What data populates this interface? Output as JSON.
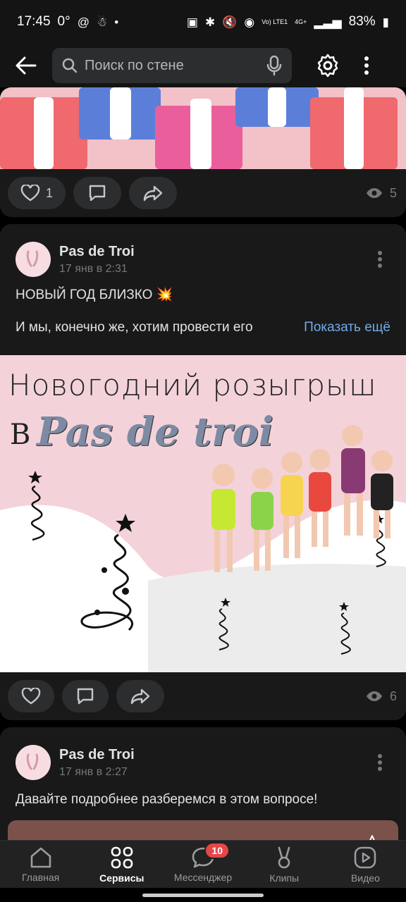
{
  "status_bar": {
    "time": "17:45",
    "left_extra": "0°",
    "battery": "83%",
    "icons": [
      "at-icon",
      "notification-icon",
      "nfc-icon",
      "bluetooth-icon",
      "mute-icon",
      "wifi-icon",
      "signal-icon",
      "battery-icon"
    ],
    "volte_label": "Vo) LTE1",
    "net_label": "4G+"
  },
  "app_bar": {
    "search_placeholder": "Поиск по стене",
    "icons": [
      "back-arrow-icon",
      "search-icon",
      "microphone-icon",
      "gear-icon",
      "more-vertical-icon"
    ]
  },
  "posts": [
    {
      "likes": "1",
      "views": "5"
    },
    {
      "author": "Pas de Troi",
      "date": "17 янв в 2:31",
      "title": "НОВЫЙ ГОД БЛИЗКО 💥",
      "excerpt": "И мы, конечно же, хотим провести его",
      "show_more": "Показать ещё",
      "image": {
        "headline": "Новогодний розыгрыш",
        "v": "В",
        "brand": "Pas de troi"
      },
      "views": "6"
    },
    {
      "author": "Pas de Troi",
      "date": "17 янв в 2:27",
      "text": "Давайте подробнее разберемся в этом вопросе!"
    }
  ],
  "bottom_nav": [
    {
      "label": "Главная",
      "icon": "home-icon"
    },
    {
      "label": "Сервисы",
      "icon": "services-icon",
      "active": true
    },
    {
      "label": "Мессенджер",
      "icon": "messenger-icon",
      "badge": "10"
    },
    {
      "label": "Клипы",
      "icon": "clips-icon"
    },
    {
      "label": "Видео",
      "icon": "video-icon"
    }
  ],
  "colors": {
    "background": "#000000",
    "card": "#191919",
    "link": "#71aaeb",
    "badge": "#e64646"
  }
}
